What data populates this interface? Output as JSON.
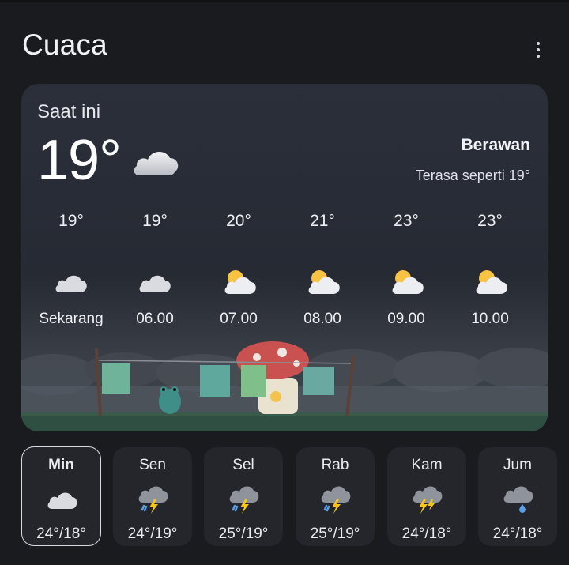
{
  "app": {
    "title": "Cuaca",
    "menu_icon": "more-vert-icon"
  },
  "current": {
    "label": "Saat ini",
    "temperature": "19°",
    "icon": "cloud-icon",
    "condition": "Berawan",
    "feels_like": "Terasa seperti 19°"
  },
  "hourly": [
    {
      "temp": "19°",
      "icon": "cloud-icon",
      "time": "Sekarang"
    },
    {
      "temp": "19°",
      "icon": "cloud-icon",
      "time": "06.00"
    },
    {
      "temp": "20°",
      "icon": "partly-sunny-icon",
      "time": "07.00"
    },
    {
      "temp": "21°",
      "icon": "partly-sunny-icon",
      "time": "08.00"
    },
    {
      "temp": "23°",
      "icon": "partly-sunny-icon",
      "time": "09.00"
    },
    {
      "temp": "23°",
      "icon": "partly-sunny-icon",
      "time": "10.00"
    }
  ],
  "daily": [
    {
      "day": "Min",
      "icon": "cloud-icon",
      "range": "24°/18°",
      "selected": true
    },
    {
      "day": "Sen",
      "icon": "thunderstorm-rain-icon",
      "range": "24°/19°"
    },
    {
      "day": "Sel",
      "icon": "thunderstorm-rain-icon",
      "range": "25°/19°"
    },
    {
      "day": "Rab",
      "icon": "thunderstorm-rain-icon",
      "range": "25°/19°"
    },
    {
      "day": "Kam",
      "icon": "thunderstorm-icon",
      "range": "24°/18°"
    },
    {
      "day": "Jum",
      "icon": "rain-icon",
      "range": "24°/18°"
    }
  ],
  "colors": {
    "background": "#1a1b1f",
    "card": "#2a2f3a",
    "sun": "#f6c343",
    "bolt": "#f5c518",
    "rain": "#5aa0e6"
  }
}
